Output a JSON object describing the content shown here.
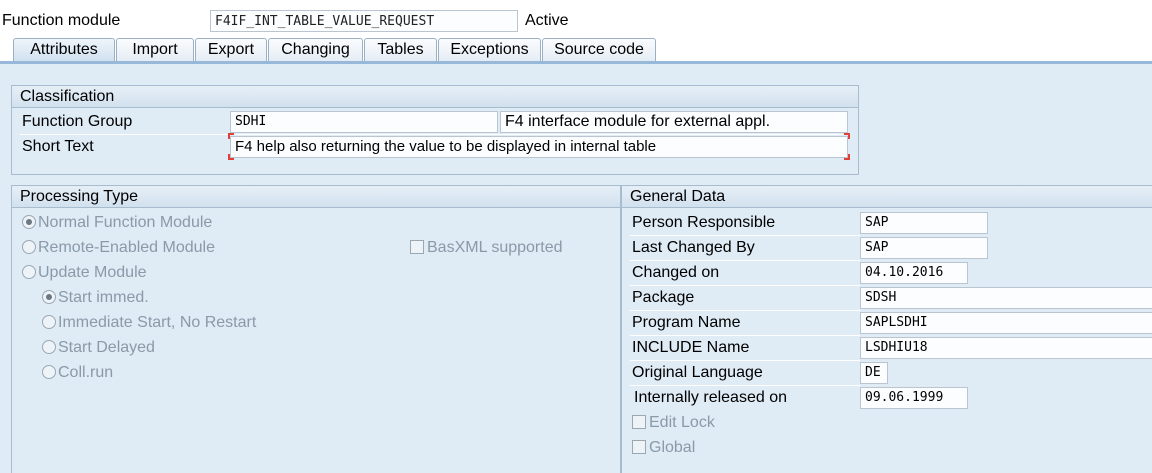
{
  "header": {
    "label": "Function module",
    "value": "F4IF_INT_TABLE_VALUE_REQUEST",
    "status": "Active"
  },
  "tabs": [
    {
      "label": "Attributes",
      "active": true
    },
    {
      "label": "Import"
    },
    {
      "label": "Export"
    },
    {
      "label": "Changing"
    },
    {
      "label": "Tables"
    },
    {
      "label": "Exceptions"
    },
    {
      "label": "Source code"
    }
  ],
  "classification": {
    "title": "Classification",
    "function_group_label": "Function Group",
    "function_group_value": "SDHI",
    "function_group_text": "F4 interface module for external appl.",
    "short_text_label": "Short Text",
    "short_text_value": "F4 help also returning the value to be displayed in internal table"
  },
  "processing_type": {
    "title": "Processing Type",
    "options": [
      {
        "label": "Normal Function Module",
        "selected": true
      },
      {
        "label": "Remote-Enabled Module",
        "selected": false
      },
      {
        "label": "Update Module",
        "selected": false
      }
    ],
    "basxml_label": "BasXML supported",
    "update_options": [
      {
        "label": "Start immed.",
        "selected": true
      },
      {
        "label": "Immediate Start, No Restart",
        "selected": false
      },
      {
        "label": "Start Delayed",
        "selected": false
      },
      {
        "label": "Coll.run",
        "selected": false
      }
    ]
  },
  "general_data": {
    "title": "General Data",
    "rows": [
      {
        "label": "Person Responsible",
        "value": "SAP"
      },
      {
        "label": "Last Changed By",
        "value": "SAP"
      },
      {
        "label": "Changed on",
        "value": "04.10.2016"
      },
      {
        "label": "Package",
        "value": "SDSH"
      },
      {
        "label": "Program Name",
        "value": "SAPLSDHI"
      },
      {
        "label": "INCLUDE Name",
        "value": "LSDHIU18"
      },
      {
        "label": "Original Language",
        "value": "DE"
      },
      {
        "label": "Internally released on",
        "value": "09.06.1999"
      }
    ],
    "edit_lock_label": "Edit Lock",
    "global_label": "Global"
  }
}
